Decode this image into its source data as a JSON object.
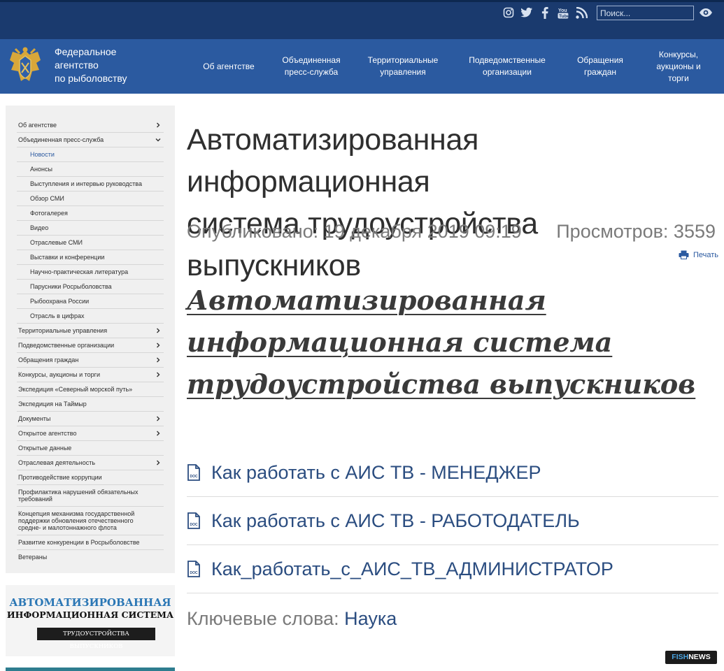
{
  "header": {
    "social_icons": [
      "instagram-icon",
      "twitter-icon",
      "facebook-icon",
      "youtube-icon",
      "rss-icon"
    ],
    "search_placeholder": "Поиск...",
    "accessibility_icon": "eye-icon"
  },
  "brand": {
    "line1": "Федеральное",
    "line2": "агентство",
    "line3": "по рыболовству"
  },
  "nav": [
    {
      "line1": "Об агентстве",
      "line2": "",
      "line3": ""
    },
    {
      "line1": "Объединенная",
      "line2": "пресс-служба",
      "line3": ""
    },
    {
      "line1": "Территориальные",
      "line2": "управления",
      "line3": ""
    },
    {
      "line1": "Подведомственные",
      "line2": "организации",
      "line3": ""
    },
    {
      "line1": "Обращения",
      "line2": "граждан",
      "line3": ""
    },
    {
      "line1": "Конкурсы,",
      "line2": "аукционы и",
      "line3": "торги"
    }
  ],
  "sidebar": {
    "items": [
      {
        "label": "Об агентстве"
      },
      {
        "label": "Объединенная пресс-служба"
      },
      {
        "label": "Новости"
      },
      {
        "label": "Анонсы"
      },
      {
        "label": "Выступления и интервью руководства"
      },
      {
        "label": "Обзор СМИ"
      },
      {
        "label": "Фотогалерея"
      },
      {
        "label": "Видео"
      },
      {
        "label": "Отраслевые СМИ"
      },
      {
        "label": "Выставки и конференции"
      },
      {
        "label": "Научно-практическая литература"
      },
      {
        "label": "Парусники Росрыболовства"
      },
      {
        "label": "Рыбоохрана России"
      },
      {
        "label": "Отрасль в цифрах"
      },
      {
        "label": "Территориальные управления"
      },
      {
        "label": "Подведомственные организации"
      },
      {
        "label": "Обращения граждан"
      },
      {
        "label": "Конкурсы, аукционы и торги"
      },
      {
        "label": "Экспедиция «Северный морской путь»"
      },
      {
        "label": "Экспедиция на Таймыр"
      },
      {
        "label": "Документы"
      },
      {
        "label": "Открытое агентство"
      },
      {
        "label": "Открытые данные"
      },
      {
        "label": "Отраслевая деятельность"
      },
      {
        "label": "Противодействие коррупции"
      },
      {
        "label": "Профилактика нарушений обязательных требований"
      },
      {
        "label": "Концепция механизма государственной поддержки обновления отечественного средне- и малотоннажного флота"
      },
      {
        "label": "Развитие конкуренции в Росрыболовстве"
      },
      {
        "label": "Ветераны"
      }
    ]
  },
  "banner": {
    "line1": "АВТОМАТИЗИРОВАННАЯ",
    "line2": "ИНФОРМАЦИОННАЯ СИСТЕМА",
    "line3": "ТРУДОУСТРОЙСТВА ВЫПУСКНИКОВ"
  },
  "article": {
    "title_line1": "Автоматизированная информационная",
    "title_line2": "система трудоустройства выпускников",
    "published": "Опубликовано: 19 декабря 2019 09:19",
    "views": "Просмотров: 3559",
    "print_label": "Печать",
    "doc_title_line1": "Автоматизированная",
    "doc_title_line2": "информационная система",
    "doc_title_line3": "трудоустройства выпускников",
    "files": [
      {
        "label": "Как работать с АИС ТВ - МЕНЕДЖЕР"
      },
      {
        "label": "Как работать с АИС ТВ - РАБОТОДАТЕЛЬ"
      },
      {
        "label": "Как_работать_с_АИС_ТВ_АДМИНИСТРАТОР"
      }
    ],
    "keywords_label": "Ключевые слова:",
    "keyword": "Наука"
  },
  "watermark": {
    "part1": "FISH",
    "part2": "NEWS"
  },
  "colors": {
    "topbar": "#1a3a6e",
    "navbar": "#2b5aa0",
    "link": "#2b4d80",
    "meta": "#7a7a7a"
  }
}
